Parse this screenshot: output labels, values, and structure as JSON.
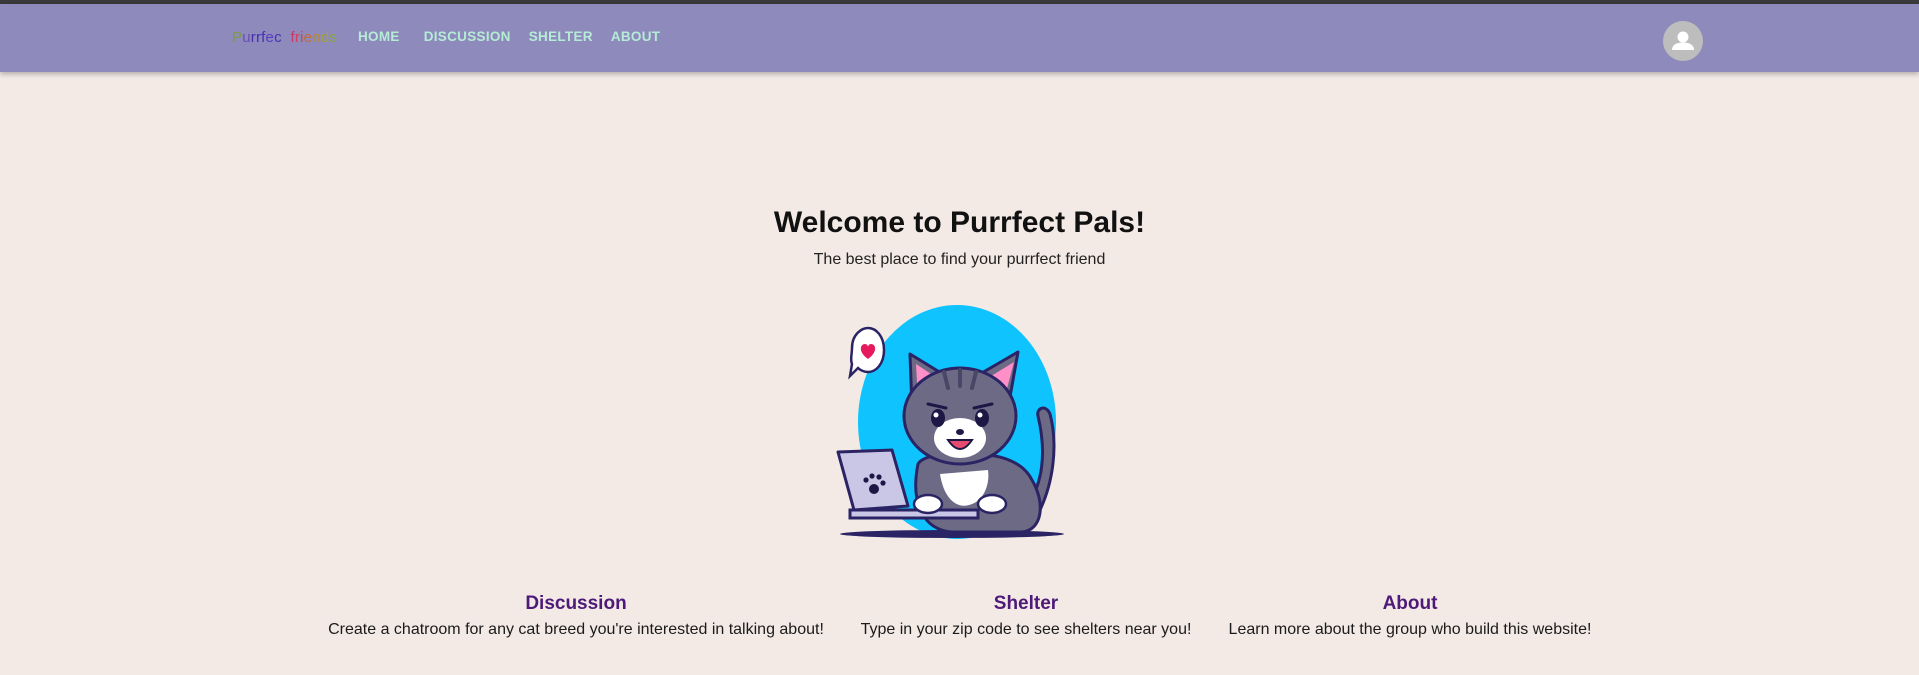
{
  "header": {
    "brand": "Purrfect friends",
    "nav": [
      "HOME",
      "DISCUSSION",
      "SHELTER",
      "ABOUT"
    ]
  },
  "avatar_icon": "person-icon",
  "hero": {
    "title": "Welcome to Purrfect Pals!",
    "subtitle": "The best place to find your purrfect friend"
  },
  "illustration": {
    "subject": "cat-with-laptop-illustration",
    "icons": [
      "heart-speech-bubble-icon",
      "paw-icon"
    ]
  },
  "features": [
    {
      "title": "Discussion",
      "description": "Create a chatroom for any cat breed you're interested in talking about!"
    },
    {
      "title": "Shelter",
      "description": "Type in your zip code to see shelters near you!"
    },
    {
      "title": "About",
      "description": "Learn more about the group who build this website!"
    }
  ],
  "colors": {
    "appbar": "#8e8abc",
    "nav_text": "#b6ecd6",
    "background": "#f3eae6",
    "feature_title": "#4e1a7a"
  }
}
